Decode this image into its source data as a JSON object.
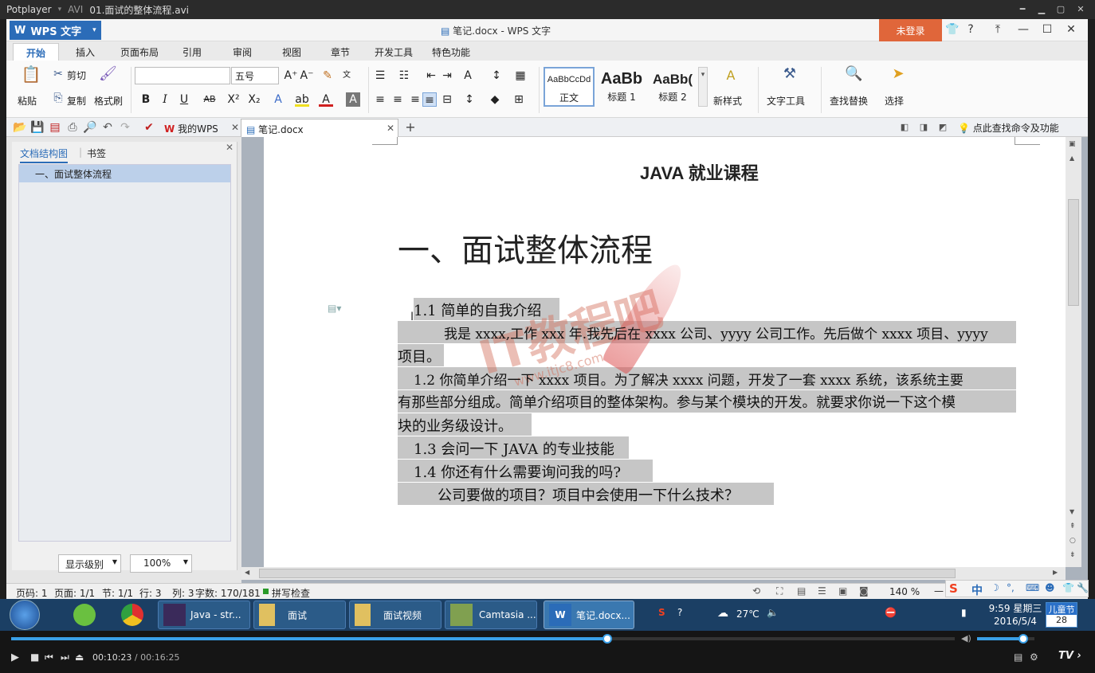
{
  "player": {
    "app_name": "Potplayer",
    "format": "AVI",
    "file_name": "01.面试的整体流程.avi",
    "time_current": "00:10:23",
    "time_total": "00:16:25",
    "progress": 0.632,
    "volume": 0.8,
    "tv_label": "TV"
  },
  "wps": {
    "app_label": "WPS 文字",
    "window_title": "笔记.docx - WPS 文字",
    "login_label": "未登录",
    "ribbon_tabs": [
      "开始",
      "插入",
      "页面布局",
      "引用",
      "审阅",
      "视图",
      "章节",
      "开发工具",
      "特色功能"
    ],
    "ribbon": {
      "paste": "粘贴",
      "cut": "剪切",
      "copy": "复制",
      "format_painter": "格式刷",
      "font_size": "五号",
      "font_name": "",
      "styles": [
        {
          "preview": "AaBbCcDd",
          "name": "正文"
        },
        {
          "preview": "AaBb",
          "name": "标题 1"
        },
        {
          "preview": "AaBb(",
          "name": "标题 2"
        }
      ],
      "new_style": "新样式",
      "text_tools": "文字工具",
      "find_replace": "查找替换",
      "select": "选择"
    },
    "doc_tabs": [
      {
        "label": "我的WPS"
      },
      {
        "label": "笔记.docx"
      }
    ],
    "search_hint": "点此查找命令及功能",
    "nav": {
      "tab_outline": "文档结构图",
      "tab_bookmark": "书签",
      "items": [
        "一、面试整体流程"
      ],
      "level_label": "显示级别",
      "zoom_label": "100%"
    },
    "document": {
      "header": "JAVA 就业课程",
      "h1": "一、面试整体流程",
      "lines": [
        {
          "text": "1.1 简单的自我介绍"
        },
        {
          "text": "我是 xxxx,工作 xxx 年.我先后在 xxxx 公司、yyyy 公司工作。先后做个 xxxx 项目、yyyy"
        },
        {
          "text": "项目。"
        },
        {
          "text": "1.2 你简单介绍一下 xxxx 项目。为了解决 xxxx 问题，开发了一套 xxxx 系统，该系统主要"
        },
        {
          "text": "有那些部分组成。简单介绍项目的整体架构。参与某个模块的开发。就要求你说一下这个模"
        },
        {
          "text": "块的业务级设计。"
        },
        {
          "text": "1.3 会问一下 JAVA 的专业技能"
        },
        {
          "text": "1.4 你还有什么需要询问我的吗?"
        },
        {
          "text": "公司要做的项目？项目中会使用一下什么技术？"
        }
      ],
      "watermark": "IT教程吧",
      "watermark_url": "www.itjc8.com"
    },
    "status": {
      "page_code": "页码: 1",
      "pages": "页面: 1/1",
      "section": "节: 1/1",
      "row": "行: 3",
      "col": "列: 3",
      "words": "字数: 170/181",
      "spell": "拼写检查",
      "zoom": "140 %"
    }
  },
  "taskbar": {
    "items": [
      "Java - str...",
      "面试",
      "面试视频",
      "Camtasia ...",
      "笔记.docx..."
    ],
    "ime": "中",
    "weather": "27℃",
    "time": "9:59 星期三",
    "date": "2016/5/4",
    "calendar_label": "儿童节",
    "calendar_day": "28"
  }
}
